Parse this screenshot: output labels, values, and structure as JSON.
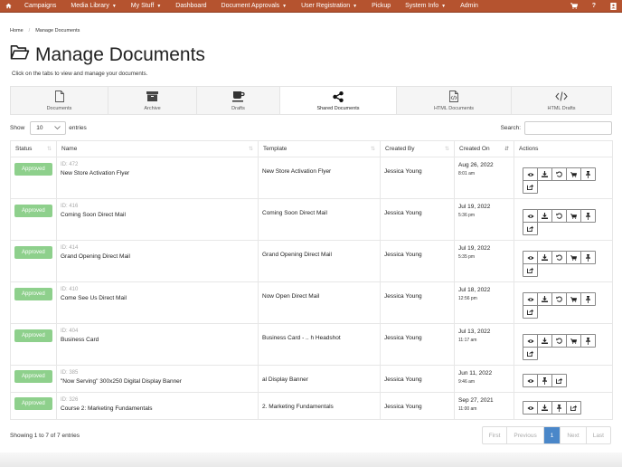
{
  "navbar": {
    "home_icon": "home-icon",
    "items": [
      {
        "label": "Campaigns",
        "dropdown": false
      },
      {
        "label": "Media Library",
        "dropdown": true
      },
      {
        "label": "My Stuff",
        "dropdown": true
      },
      {
        "label": "Dashboard",
        "dropdown": false
      },
      {
        "label": "Document Approvals",
        "dropdown": true
      },
      {
        "label": "User Registration",
        "dropdown": true
      },
      {
        "label": "Pickup",
        "dropdown": false
      },
      {
        "label": "System Info",
        "dropdown": true
      },
      {
        "label": "Admin",
        "dropdown": false
      }
    ],
    "right_icons": [
      "cart-icon",
      "help-icon",
      "user-card-icon"
    ],
    "help_label": "?",
    "color": "#b5532f"
  },
  "breadcrumb": {
    "items": [
      "Home",
      "Manage Documents"
    ],
    "separator": "/"
  },
  "page": {
    "title": "Manage Documents",
    "title_icon": "folder-open-icon",
    "subtitle": "Click on the tabs to view and manage your documents."
  },
  "tabs": [
    {
      "label": "Documents",
      "icon": "file-icon",
      "active": false
    },
    {
      "label": "Archive",
      "icon": "archive-icon",
      "active": false
    },
    {
      "label": "Drafts",
      "icon": "coffee-icon",
      "active": false
    },
    {
      "label": "Shared Documents",
      "icon": "share-icon",
      "active": true
    },
    {
      "label": "HTML Documents",
      "icon": "file-code-icon",
      "active": false
    },
    {
      "label": "HTML Drafts",
      "icon": "code-icon",
      "active": false
    }
  ],
  "controls": {
    "show_label": "Show",
    "entries_label": "entries",
    "page_length": "10",
    "search_label": "Search:",
    "search_value": ""
  },
  "table": {
    "columns": [
      "Status",
      "Name",
      "Template",
      "Created By",
      "Created On",
      "Actions"
    ],
    "rows": [
      {
        "status": "Approved",
        "id": "ID: 472",
        "name": "New Store Activation Flyer",
        "template": "New Store Activation Flyer",
        "created_by": "Jessica Young",
        "date": "Aug 26, 2022",
        "time": "8:01 am",
        "actions": [
          "view",
          "download",
          "revert",
          "cart",
          "pin",
          "share"
        ]
      },
      {
        "status": "Approved",
        "id": "ID: 416",
        "name": "Coming Soon Direct Mail",
        "template": "Coming Soon Direct Mail",
        "created_by": "Jessica Young",
        "date": "Jul 19, 2022",
        "time": "5:36 pm",
        "actions": [
          "view",
          "download",
          "revert",
          "cart",
          "pin",
          "share"
        ]
      },
      {
        "status": "Approved",
        "id": "ID: 414",
        "name": "Grand Opening Direct Mail",
        "template": "Grand Opening Direct Mail",
        "created_by": "Jessica Young",
        "date": "Jul 19, 2022",
        "time": "5:35 pm",
        "actions": [
          "view",
          "download",
          "revert",
          "cart",
          "pin",
          "share"
        ]
      },
      {
        "status": "Approved",
        "id": "ID: 410",
        "name": "Come See Us Direct Mail",
        "template": "Now Open Direct Mail",
        "created_by": "Jessica Young",
        "date": "Jul 18, 2022",
        "time": "12:56 pm",
        "actions": [
          "view",
          "download",
          "revert",
          "cart",
          "pin",
          "share"
        ]
      },
      {
        "status": "Approved",
        "id": "ID: 404",
        "name": "Business Card",
        "template": "Business Card - .. h Headshot",
        "created_by": "Jessica Young",
        "date": "Jul 13, 2022",
        "time": "11:17 am",
        "actions": [
          "view",
          "download",
          "revert",
          "cart",
          "pin",
          "share"
        ]
      },
      {
        "status": "Approved",
        "id": "ID: 385",
        "name": "\"Now Serving\" 300x250 Digital Display Banner",
        "template": "al Display Banner",
        "created_by": "Jessica Young",
        "date": "Jun 11, 2022",
        "time": "9:46 am",
        "actions": [
          "view",
          "pin",
          "share"
        ]
      },
      {
        "status": "Approved",
        "id": "ID: 326",
        "name": "Course 2: Marketing Fundamentals",
        "template": "2. Marketing Fundamentals",
        "created_by": "Jessica Young",
        "date": "Sep 27, 2021",
        "time": "11:00 am",
        "actions": [
          "view",
          "download",
          "pin",
          "share"
        ]
      }
    ]
  },
  "footer": {
    "info": "Showing 1 to 7 of 7 entries",
    "pagination": [
      {
        "label": "First",
        "active": false
      },
      {
        "label": "Previous",
        "active": false
      },
      {
        "label": "1",
        "active": true
      },
      {
        "label": "Next",
        "active": false
      },
      {
        "label": "Last",
        "active": false
      }
    ]
  },
  "colors": {
    "navbar": "#b5532f",
    "approved_badge": "#8ed08c",
    "pagination_active": "#4a87c9"
  }
}
